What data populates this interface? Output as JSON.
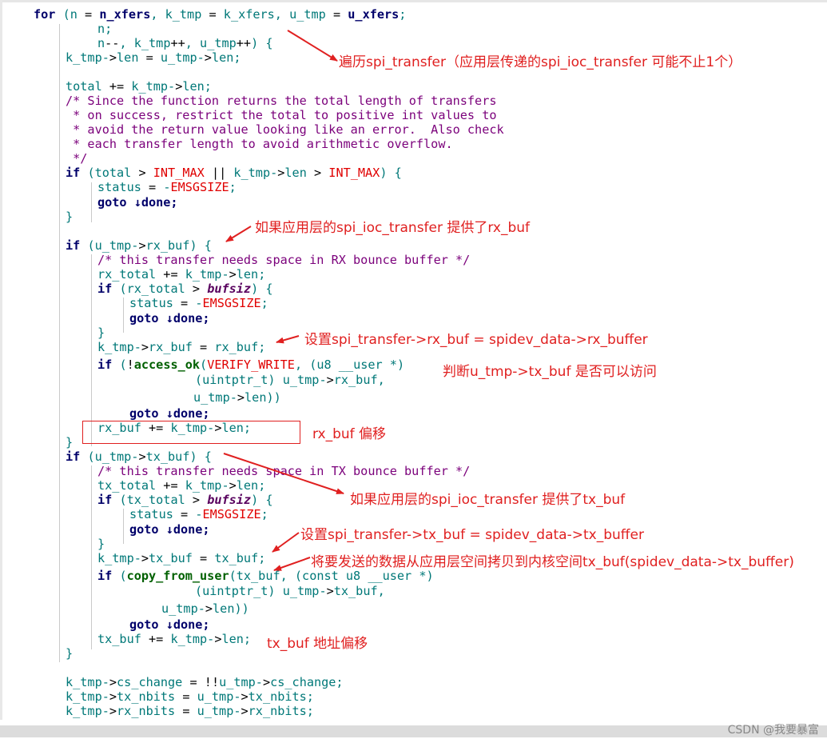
{
  "code_lines": [
    "for (n = n_xfers, k_tmp = k_xfers, u_tmp = u_xfers;",
    "n;",
    "n--, k_tmp++, u_tmp++) {",
    "k_tmp->len = u_tmp->len;",
    "total += k_tmp->len;",
    "/* Since the function returns the total length of transfers",
    " * on success, restrict the total to positive int values to",
    " * avoid the return value looking like an error.  Also check",
    " * each transfer length to avoid arithmetic overflow.",
    " */",
    "if (total > INT_MAX || k_tmp->len > INT_MAX) {",
    "status = -EMSGSIZE;",
    "goto ↓done;",
    "}",
    "if (u_tmp->rx_buf) {",
    "/* this transfer needs space in RX bounce buffer */",
    "rx_total += k_tmp->len;",
    "if (rx_total > bufsiz) {",
    "status = -EMSGSIZE;",
    "goto ↓done;",
    "}",
    "k_tmp->rx_buf = rx_buf;",
    "if (!access_ok(VERIFY_WRITE, (u8 __user *)",
    "(uintptr_t) u_tmp->rx_buf,",
    "u_tmp->len))",
    "goto ↓done;",
    "rx_buf += k_tmp->len;",
    "}",
    "if (u_tmp->tx_buf) {",
    "/* this transfer needs space in TX bounce buffer */",
    "tx_total += k_tmp->len;",
    "if (tx_total > bufsiz) {",
    "status = -EMSGSIZE;",
    "goto ↓done;",
    "}",
    "k_tmp->tx_buf = tx_buf;",
    "if (copy_from_user(tx_buf, (const u8 __user *)",
    "(uintptr_t) u_tmp->tx_buf,",
    "u_tmp->len))",
    "goto ↓done;",
    "tx_buf += k_tmp->len;",
    "}",
    "k_tmp->cs_change = !!u_tmp->cs_change;",
    "k_tmp->tx_nbits = u_tmp->tx_nbits;",
    "k_tmp->rx_nbits = u_tmp->rx_nbits;"
  ],
  "annotations": {
    "a1": "遍历spi_transfer（应用层传递的spi_ioc_transfer 可能不止1个）",
    "a2": "如果应用层的spi_ioc_transfer 提供了rx_buf",
    "a3": "设置spi_transfer->rx_buf = spidev_data->rx_buffer",
    "a4": "判断u_tmp->tx_buf 是否可以访问",
    "a5": "rx_buf 偏移",
    "a6": "如果应用层的spi_ioc_transfer 提供了tx_buf",
    "a7": "设置spi_transfer->tx_buf = spidev_data->tx_buffer",
    "a8": "将要发送的数据从应用层空间拷贝到内核空间tx_buf(spidev_data->tx_buffer)",
    "a9": "tx_buf 地址偏移"
  },
  "watermark": "CSDN @我要暴富",
  "colors": {
    "keyword": "#00006a",
    "function": "#006000",
    "macro": "#e00000",
    "comment": "#7b007b",
    "variable": "#007878",
    "annotation": "#e02020"
  }
}
